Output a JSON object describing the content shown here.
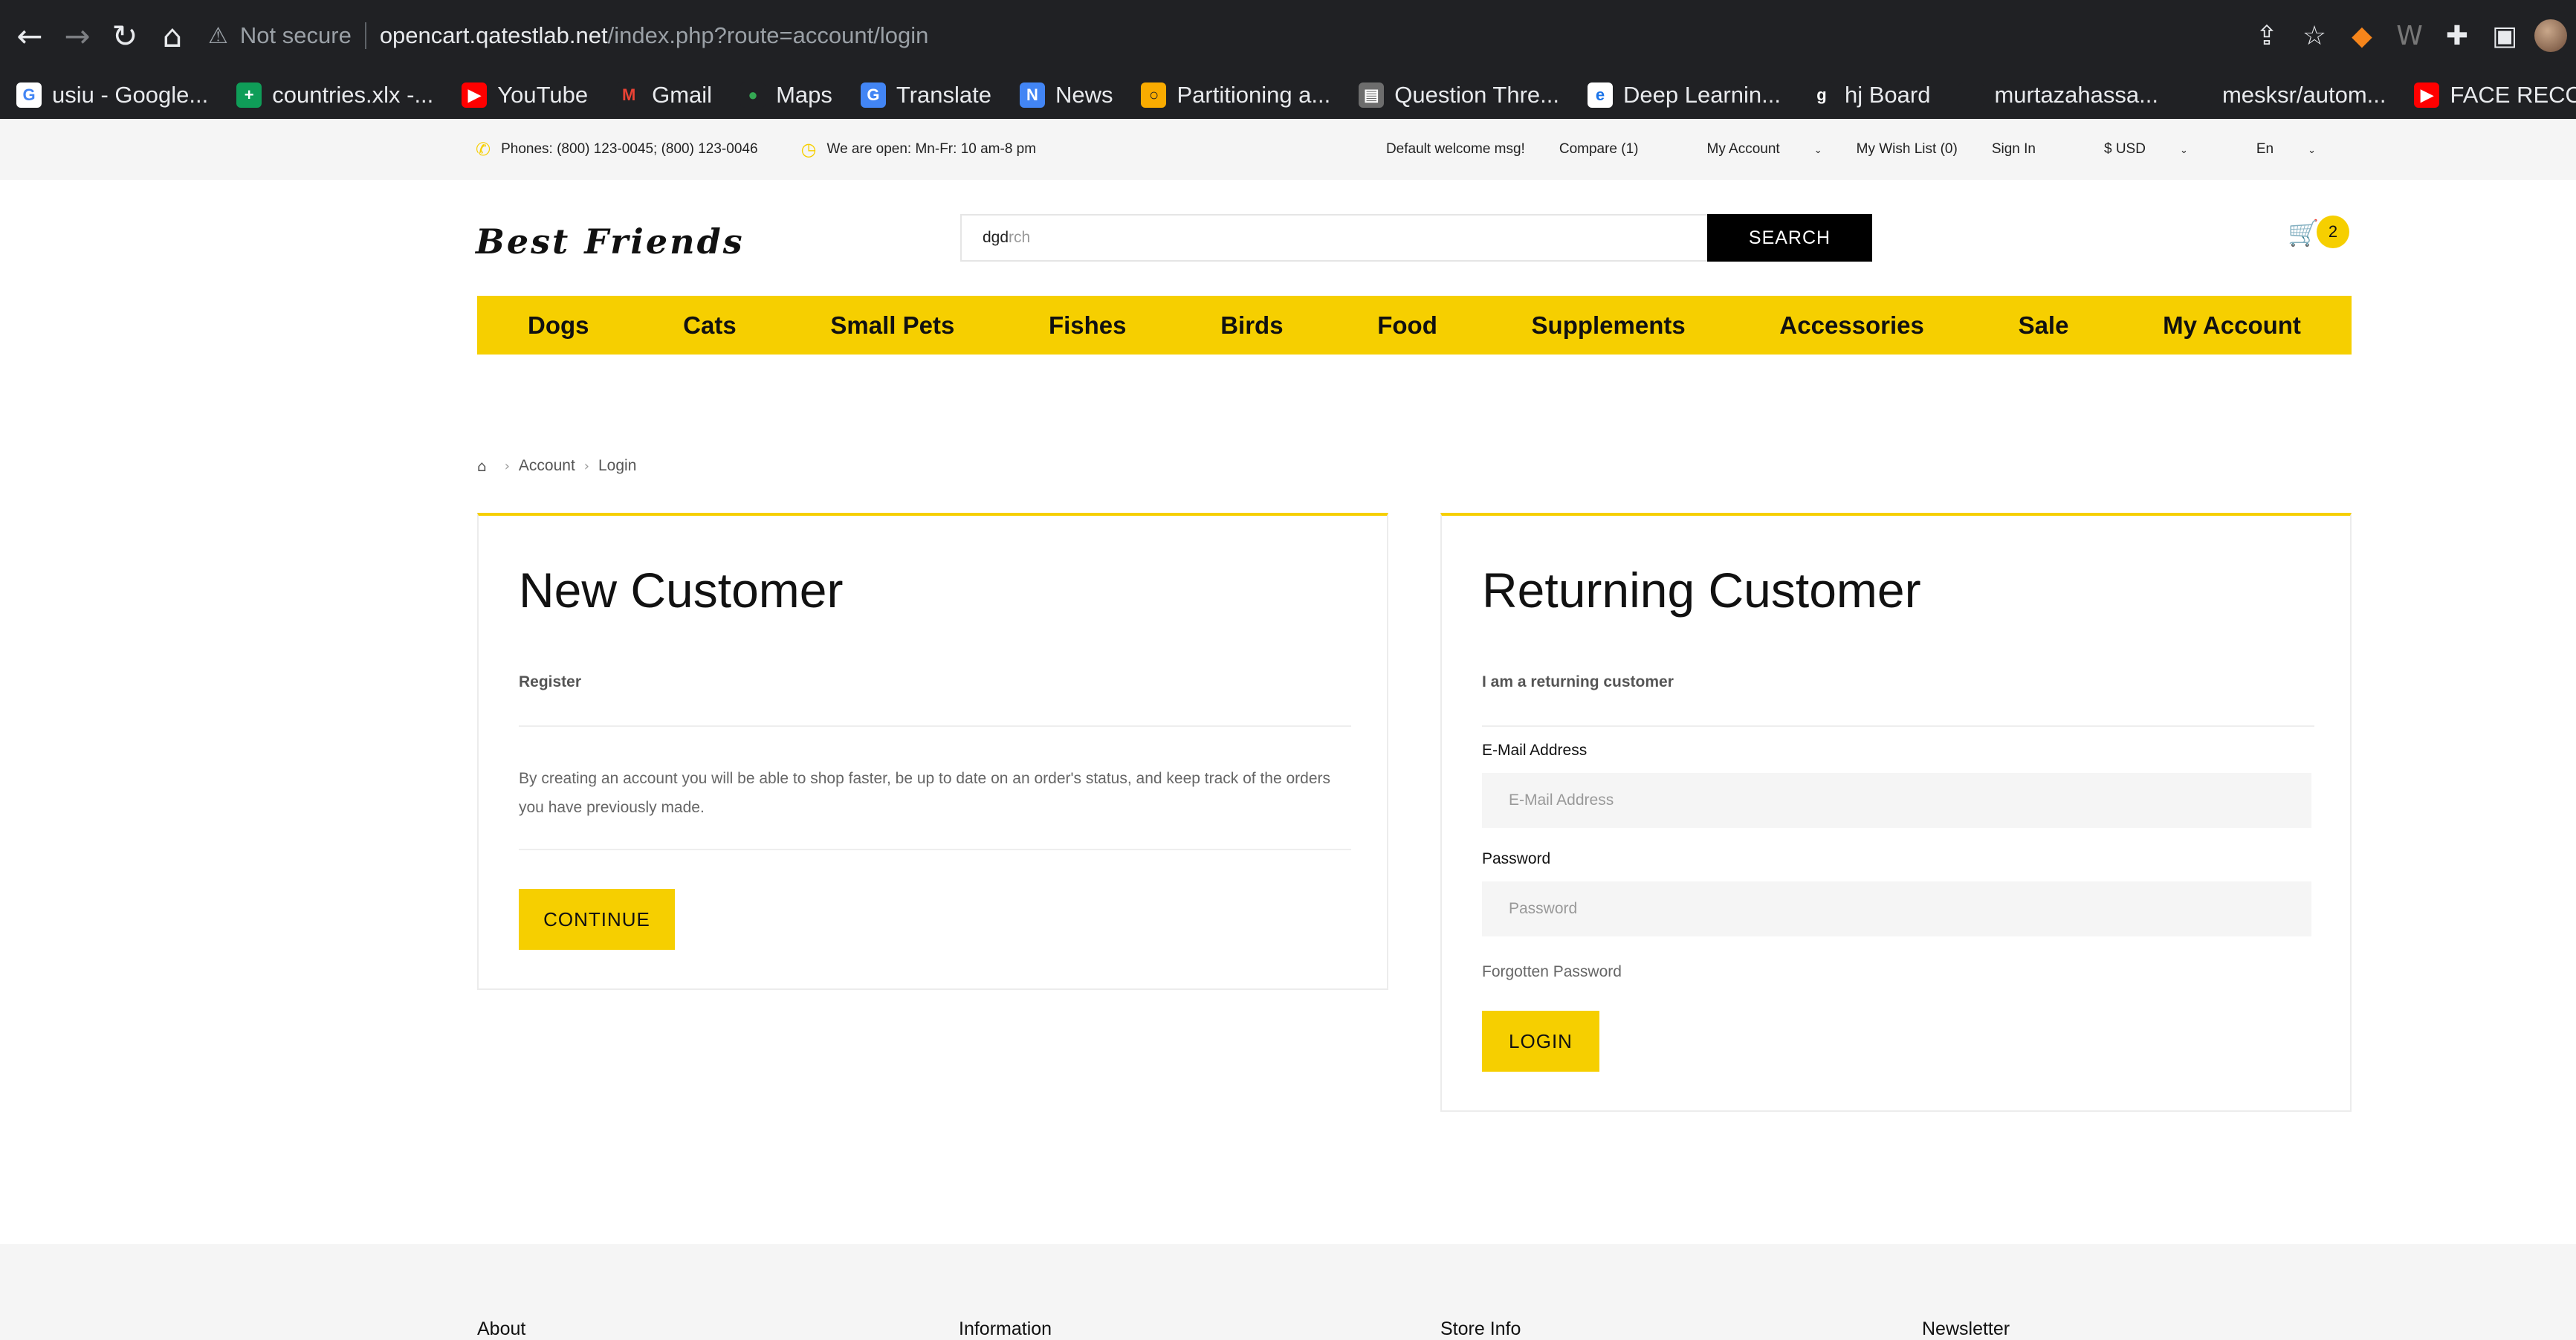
{
  "browser": {
    "url_host": "opencart.qatestlab.net",
    "url_path": "/index.php?route=account/login",
    "security_label": "Not secure",
    "bookmarks": [
      {
        "label": "usiu - Google...",
        "icon": "google-icon",
        "color": "#ffffff",
        "glyph": "G",
        "glyph_color": "#4285f4"
      },
      {
        "label": "countries.xlx -...",
        "icon": "sheets-icon",
        "color": "#0f9d58",
        "glyph": "+",
        "glyph_color": "#ffffff"
      },
      {
        "label": "YouTube",
        "icon": "youtube-icon",
        "color": "#ff0000",
        "glyph": "▶",
        "glyph_color": "#ffffff"
      },
      {
        "label": "Gmail",
        "icon": "gmail-icon",
        "color": "#202124",
        "glyph": "M",
        "glyph_color": "#ea4335"
      },
      {
        "label": "Maps",
        "icon": "maps-icon",
        "color": "#202124",
        "glyph": "●",
        "glyph_color": "#34a853"
      },
      {
        "label": "Translate",
        "icon": "translate-icon",
        "color": "#4285f4",
        "glyph": "G",
        "glyph_color": "#ffffff"
      },
      {
        "label": "News",
        "icon": "news-icon",
        "color": "#4285f4",
        "glyph": "N",
        "glyph_color": "#ffffff"
      },
      {
        "label": "Partitioning a...",
        "icon": "partition-icon",
        "color": "#f9ab00",
        "glyph": "○",
        "glyph_color": "#202124"
      },
      {
        "label": "Question Thre...",
        "icon": "question-icon",
        "color": "#6d6d6d",
        "glyph": "▤",
        "glyph_color": "#ffffff"
      },
      {
        "label": "Deep Learnin...",
        "icon": "deep-learning-icon",
        "color": "#ffffff",
        "glyph": "e",
        "glyph_color": "#1a73e8"
      },
      {
        "label": "hj Board",
        "icon": "board-icon",
        "color": "#202124",
        "glyph": "g",
        "glyph_color": "#ffffff"
      },
      {
        "label": "murtazahassa...",
        "icon": "github-icon",
        "color": "#202124",
        "glyph": "",
        "glyph_color": "#ffffff"
      },
      {
        "label": "mesksr/autom...",
        "icon": "github-icon",
        "color": "#202124",
        "glyph": "",
        "glyph_color": "#ffffff"
      },
      {
        "label": "FACE RECOGN...",
        "icon": "youtube-icon",
        "color": "#ff0000",
        "glyph": "▶",
        "glyph_color": "#ffffff"
      }
    ]
  },
  "topbar": {
    "phones": "Phones: (800) 123-0045; (800) 123-0046",
    "hours": "We are open: Mn-Fr: 10 am-8 pm",
    "welcome": "Default welcome msg!",
    "compare": "Compare (1)",
    "my_account": "My Account",
    "wishlist": "My Wish List (0)",
    "sign_in": "Sign In",
    "currency": "$ USD",
    "language": "En"
  },
  "header": {
    "logo": "Best Friends",
    "search_typed": "dgd",
    "search_placeholder": "rch",
    "search_button": "SEARCH",
    "cart_count": "2"
  },
  "mainnav": [
    "Dogs",
    "Cats",
    "Small Pets",
    "Fishes",
    "Birds",
    "Food",
    "Supplements",
    "Accessories",
    "Sale",
    "My Account"
  ],
  "breadcrumb": [
    "Account",
    "Login"
  ],
  "new_customer": {
    "title": "New Customer",
    "subtitle": "Register",
    "text": "By creating an account you will be able to shop faster, be up to date on an order's status, and keep track of the orders you have previously made.",
    "button": "CONTINUE"
  },
  "returning_customer": {
    "title": "Returning Customer",
    "subtitle": "I am a returning customer",
    "email_label": "E-Mail Address",
    "email_placeholder": "E-Mail Address",
    "password_label": "Password",
    "password_placeholder": "Password",
    "forgot": "Forgotten Password",
    "button": "LOGIN"
  },
  "footer": {
    "columns": [
      "About",
      "Information",
      "Store Info",
      "Newsletter"
    ]
  },
  "colors": {
    "accent": "#f6cf00",
    "chrome_bg": "#202124"
  }
}
